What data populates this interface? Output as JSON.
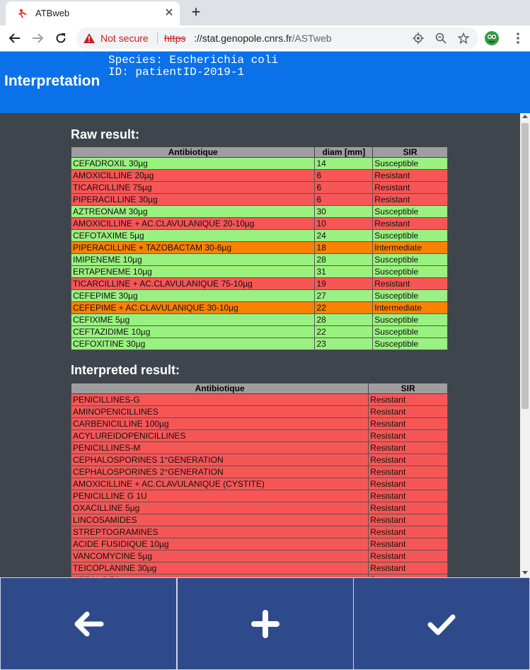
{
  "browser": {
    "tab_title": "ATBweb",
    "security_label": "Not secure",
    "url_protocol": "https",
    "url_host": "://stat.genopole.cnrs.fr",
    "url_path": "/ASTweb"
  },
  "header": {
    "title": "Interpretation",
    "species_line": "Species: Escherichia coli",
    "id_line": "ID: patientID-2019-1"
  },
  "raw_result": {
    "title": "Raw result:",
    "columns": [
      "Antibiotique",
      "diam [mm]",
      "SIR"
    ],
    "rows": [
      {
        "antibiotic": "CEFADROXIL 30µg",
        "diam": "14",
        "sir": "Susceptible"
      },
      {
        "antibiotic": "AMOXICILLINE 20µg",
        "diam": "6",
        "sir": "Resistant"
      },
      {
        "antibiotic": "TICARCILLINE 75µg",
        "diam": "6",
        "sir": "Resistant"
      },
      {
        "antibiotic": "PIPERACILLINE 30µg",
        "diam": "6",
        "sir": "Resistant"
      },
      {
        "antibiotic": "AZTREONAM 30µg",
        "diam": "30",
        "sir": "Susceptible"
      },
      {
        "antibiotic": "AMOXICILLINE + AC.CLAVULANIQUE 20-10µg",
        "diam": "10",
        "sir": "Resistant"
      },
      {
        "antibiotic": "CEFOTAXIME 5µg",
        "diam": "24",
        "sir": "Susceptible"
      },
      {
        "antibiotic": "PIPERACILLINE + TAZOBACTAM 30-6µg",
        "diam": "18",
        "sir": "Intermediate"
      },
      {
        "antibiotic": "IMIPENEME 10µg",
        "diam": "28",
        "sir": "Susceptible"
      },
      {
        "antibiotic": "ERTAPENEME 10µg",
        "diam": "31",
        "sir": "Susceptible"
      },
      {
        "antibiotic": "TICARCILLINE + AC.CLAVULANIQUE 75-10µg",
        "diam": "19",
        "sir": "Resistant"
      },
      {
        "antibiotic": "CEFEPIME 30µg",
        "diam": "27",
        "sir": "Susceptible"
      },
      {
        "antibiotic": "CEFEPIME + AC.CLAVULANIQUE 30-10µg",
        "diam": "22",
        "sir": "Intermediate"
      },
      {
        "antibiotic": "CEFIXIME 5µg",
        "diam": "28",
        "sir": "Susceptible"
      },
      {
        "antibiotic": "CEFTAZIDIME 10µg",
        "diam": "22",
        "sir": "Susceptible"
      },
      {
        "antibiotic": "CEFOXITINE 30µg",
        "diam": "23",
        "sir": "Susceptible"
      }
    ]
  },
  "interpreted_result": {
    "title": "Interpreted result:",
    "columns": [
      "Antibiotique",
      "SIR"
    ],
    "rows": [
      {
        "antibiotic": "PENICILLINES-G",
        "sir": "Resistant"
      },
      {
        "antibiotic": "AMINOPENICILLINES",
        "sir": "Resistant"
      },
      {
        "antibiotic": "CARBENICILLINE 100µg",
        "sir": "Resistant"
      },
      {
        "antibiotic": "ACYLUREIDOPENICILLINES",
        "sir": "Resistant"
      },
      {
        "antibiotic": "PENICILLINES-M",
        "sir": "Resistant"
      },
      {
        "antibiotic": "CEPHALOSPORINES 1°GENERATION",
        "sir": "Resistant"
      },
      {
        "antibiotic": "CEPHALOSPORINES 2°GENERATION",
        "sir": "Resistant"
      },
      {
        "antibiotic": "AMOXICILLINE + AC.CLAVULANIQUE (CYSTITE)",
        "sir": "Resistant"
      },
      {
        "antibiotic": "PENICILLINE G 1U",
        "sir": "Resistant"
      },
      {
        "antibiotic": "OXACILLINE 5µg",
        "sir": "Resistant"
      },
      {
        "antibiotic": "LINCOSAMIDES",
        "sir": "Resistant"
      },
      {
        "antibiotic": "STREPTOGRAMINES",
        "sir": "Resistant"
      },
      {
        "antibiotic": "ACIDE FUSIDIQUE 10µg",
        "sir": "Resistant"
      },
      {
        "antibiotic": "VANCOMYCINE 5µg",
        "sir": "Resistant"
      },
      {
        "antibiotic": "TEICOPLANINE 30µg",
        "sir": "Resistant"
      },
      {
        "antibiotic": "KETOLIDES",
        "sir": "Resistant"
      }
    ]
  },
  "colors": {
    "header_blue": "#0a71e8",
    "background": "#3f454d",
    "susceptible": "#99f27f",
    "resistant": "#f75656",
    "intermediate": "#fb8200",
    "button_blue": "#2e4a8a"
  },
  "bottom_buttons": [
    {
      "name": "back-button",
      "icon": "arrow-left-icon"
    },
    {
      "name": "add-button",
      "icon": "plus-icon"
    },
    {
      "name": "confirm-button",
      "icon": "check-icon"
    }
  ]
}
